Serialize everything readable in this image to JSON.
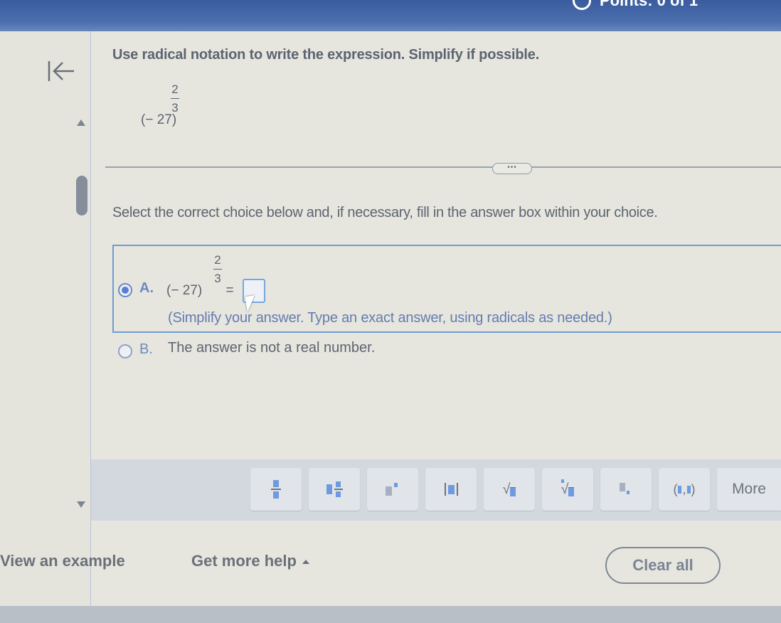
{
  "header": {
    "points_label": "Points: 0 of 1"
  },
  "question": {
    "instruction": "Use radical notation to write the expression. Simplify if possible.",
    "expression": {
      "base": "(− 27)",
      "exp_num": "2",
      "exp_den": "3"
    }
  },
  "divider": {
    "more_label": "•••"
  },
  "prompt": "Select the correct choice below and, if necessary, fill in the answer box within your choice.",
  "choices": [
    {
      "label": "A.",
      "selected": true,
      "expression": {
        "base": "(− 27)",
        "exp_num": "2",
        "exp_den": "3",
        "equals": "="
      },
      "answer_value": "",
      "hint": "(Simplify your answer. Type an exact answer, using radicals as needed.)"
    },
    {
      "label": "B.",
      "selected": false,
      "text": "The answer is not a real number."
    }
  ],
  "math_toolbar": {
    "buttons": [
      {
        "name": "fraction",
        "icon": "fraction-icon"
      },
      {
        "name": "mixed-number",
        "icon": "mixed-number-icon"
      },
      {
        "name": "exponent",
        "icon": "exponent-icon"
      },
      {
        "name": "absolute-value",
        "icon": "absolute-value-icon"
      },
      {
        "name": "square-root",
        "icon": "square-root-icon"
      },
      {
        "name": "nth-root",
        "icon": "nth-root-icon"
      },
      {
        "name": "subscript",
        "icon": "subscript-icon"
      },
      {
        "name": "ordered-pair",
        "icon": "ordered-pair-icon"
      }
    ],
    "more_label": "More"
  },
  "footer": {
    "view_example": "View an example",
    "get_more_help": "Get more help",
    "clear_all": "Clear all"
  }
}
